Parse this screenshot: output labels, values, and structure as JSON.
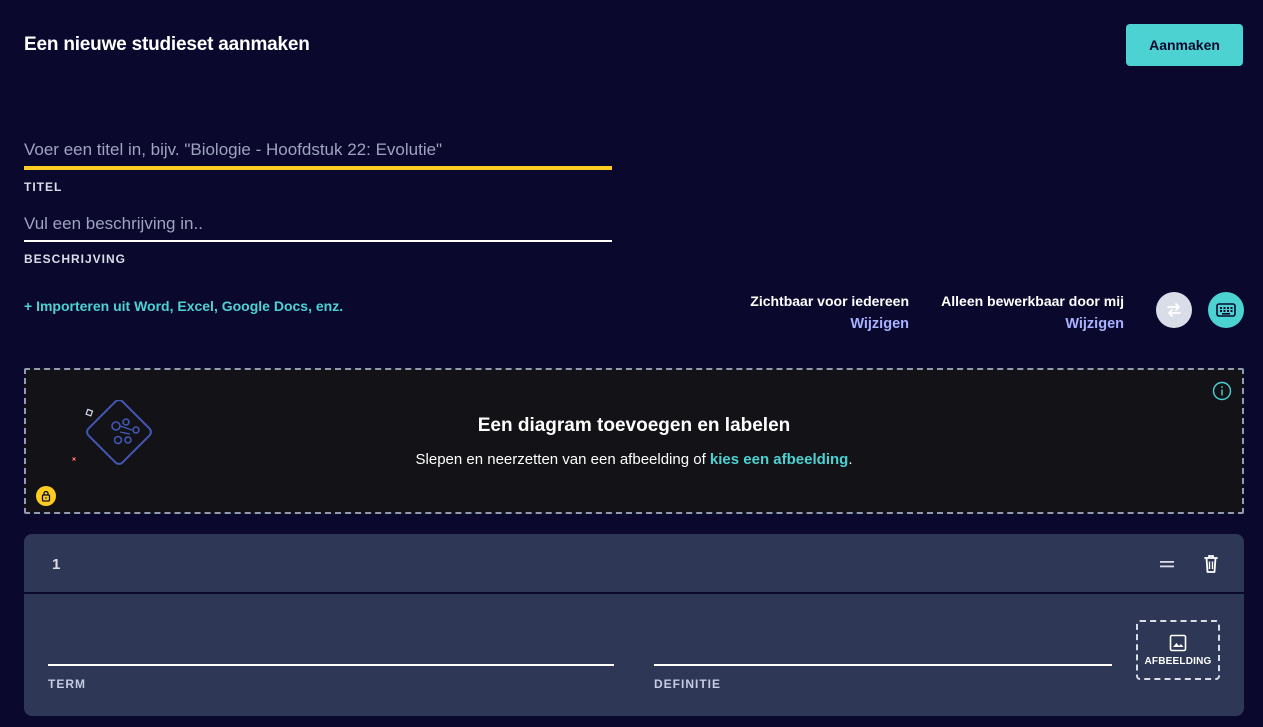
{
  "header": {
    "title": "Een nieuwe studieset aanmaken",
    "create_label": "Aanmaken"
  },
  "form": {
    "title_placeholder": "Voer een titel in, bijv. \"Biologie - Hoofdstuk 22: Evolutie\"",
    "title_label": "TITEL",
    "description_placeholder": "Vul een beschrijving in..",
    "description_label": "BESCHRIJVING",
    "import_link": "+ Importeren uit Word, Excel, Google Docs, enz."
  },
  "visibility": {
    "view_label": "Zichtbaar voor iedereen",
    "view_change": "Wijzigen",
    "edit_label": "Alleen bewerkbaar door mij",
    "edit_change": "Wijzigen"
  },
  "diagram": {
    "title": "Een diagram toevoegen en labelen",
    "subtitle_prefix": "Slepen en neerzetten van een afbeelding of ",
    "subtitle_link": "kies een afbeelding",
    "subtitle_suffix": "."
  },
  "cards": [
    {
      "number": "1",
      "term_label": "TERM",
      "definition_label": "DEFINITIE",
      "image_label": "AFBEELDING"
    }
  ],
  "colors": {
    "background": "#0a092d",
    "accent": "#4dd2d2",
    "active_underline": "#ffcd1f",
    "link_purple": "#a8b1ff",
    "card_bg": "#2e3856"
  },
  "icons": {
    "swap": "swap-icon",
    "keyboard": "keyboard-icon",
    "info": "info-icon",
    "lock": "lock-icon",
    "drag": "drag-handle-icon",
    "trash": "trash-icon",
    "image": "image-icon"
  }
}
